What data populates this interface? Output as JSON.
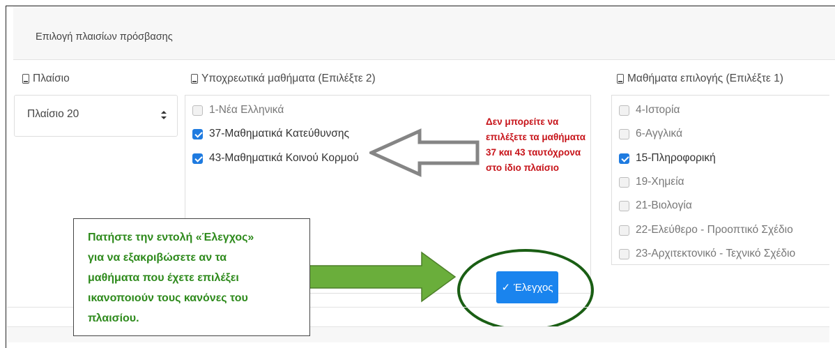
{
  "card": {
    "title": "Επιλογή πλαισίων πρόσβασης"
  },
  "columns": {
    "plaisio_label": "Πλαίσιο",
    "mandatory_label": "Υποχρεωτικά μαθήματα (Επιλέξτε 2)",
    "elective_label": "Μαθήματα επιλογής (Επιλέξτε 1)"
  },
  "plaisio_select": {
    "value": "Πλαίσιο 20"
  },
  "mandatory_courses": [
    {
      "label": "1-Νέα Ελληνικά",
      "checked": false
    },
    {
      "label": "37-Μαθηματικά Κατεύθυνσης",
      "checked": true
    },
    {
      "label": "43-Μαθηματικά Κοινού Κορμού",
      "checked": true
    }
  ],
  "elective_courses": [
    {
      "label": "4-Ιστορία",
      "checked": false
    },
    {
      "label": "6-Αγγλικά",
      "checked": false
    },
    {
      "label": "15-Πληροφορική",
      "checked": true
    },
    {
      "label": "19-Χημεία",
      "checked": false
    },
    {
      "label": "21-Βιολογία",
      "checked": false
    },
    {
      "label": "22-Ελεύθερο - Προοπτικό Σχέδιο",
      "checked": false
    },
    {
      "label": "23-Αρχιτεκτονικό - Τεχνικό Σχέδιο",
      "checked": false
    }
  ],
  "annotations": {
    "red_note": [
      "Δεν μπορείτε να",
      "επιλέξετε τα μαθήματα",
      "37 και 43 ταυτόχρονα",
      "στο ίδιο πλαίσιο"
    ],
    "green_note": [
      "Πατήστε την εντολή «Έλεγχος»",
      "για να εξακριβώσετε αν τα",
      "μαθήματα που έχετε επιλέξει",
      "ικανοποιούν τους κανόνες του",
      "πλαισίου."
    ]
  },
  "check_button": {
    "icon": "checkmark",
    "label": "Έλεγχος"
  },
  "colors": {
    "primary": "#1a84ee",
    "checkbox_on": "#1f7be0",
    "warning_red": "#c7141a",
    "note_green": "#2e8a1c",
    "ellipse_green": "#1a5e14",
    "arrow_green": "#6aae3b"
  }
}
